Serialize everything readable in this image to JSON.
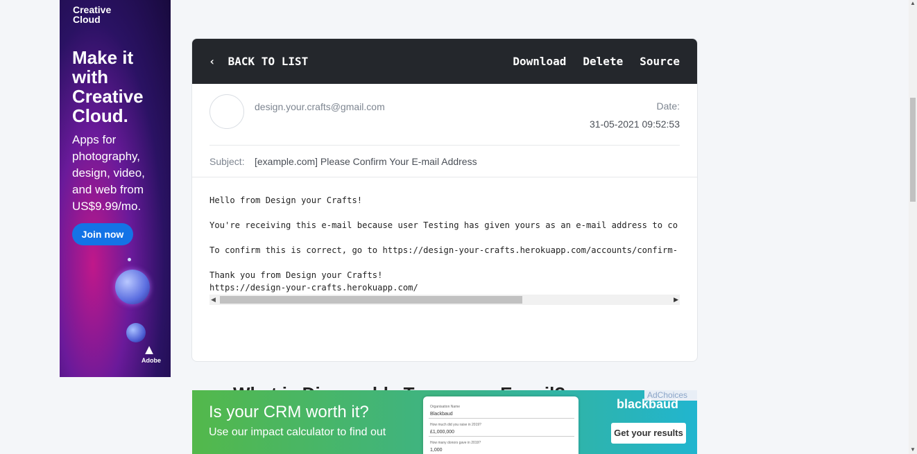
{
  "left_ad": {
    "brand": "Creative\nCloud",
    "headline": "Make it with Creative Cloud.",
    "subtext": "Apps for photography, design, video, and web from US$9.99/mo.",
    "cta": "Join now",
    "logo_text": "Adobe"
  },
  "email": {
    "back_label": "BACK TO LIST",
    "actions": {
      "download": "Download",
      "delete": "Delete",
      "source": "Source"
    },
    "from": "design.your.crafts@gmail.com",
    "date_label": "Date:",
    "date_value": "31-05-2021 09:52:53",
    "subject_label": "Subject:",
    "subject_value": "[example.com] Please Confirm Your E-mail Address",
    "body": "Hello from Design your Crafts!\n\nYou're receiving this e-mail because user Testing has given yours as an e-mail address to co\n\nTo confirm this is correct, go to https://design-your-crafts.herokuapp.com/accounts/confirm-\n\nThank you from Design your Crafts!\nhttps://design-your-crafts.herokuapp.com/"
  },
  "peek_heading": "What is Disposable Temporary E-mail?",
  "bottom_ad": {
    "headline": "Is your CRM worth it?",
    "subline": "Use our impact calculator to find out",
    "form_fields": [
      {
        "label": "Organisation Name",
        "value": "Blackbaud"
      },
      {
        "label": "How much did you raise in 2019?",
        "value": "£1,000,000"
      },
      {
        "label": "How many donors gave in 2019?",
        "value": "1,000"
      }
    ],
    "brand": "blackbaud",
    "cta": "Get your results",
    "adchoices": "AdChoices"
  }
}
